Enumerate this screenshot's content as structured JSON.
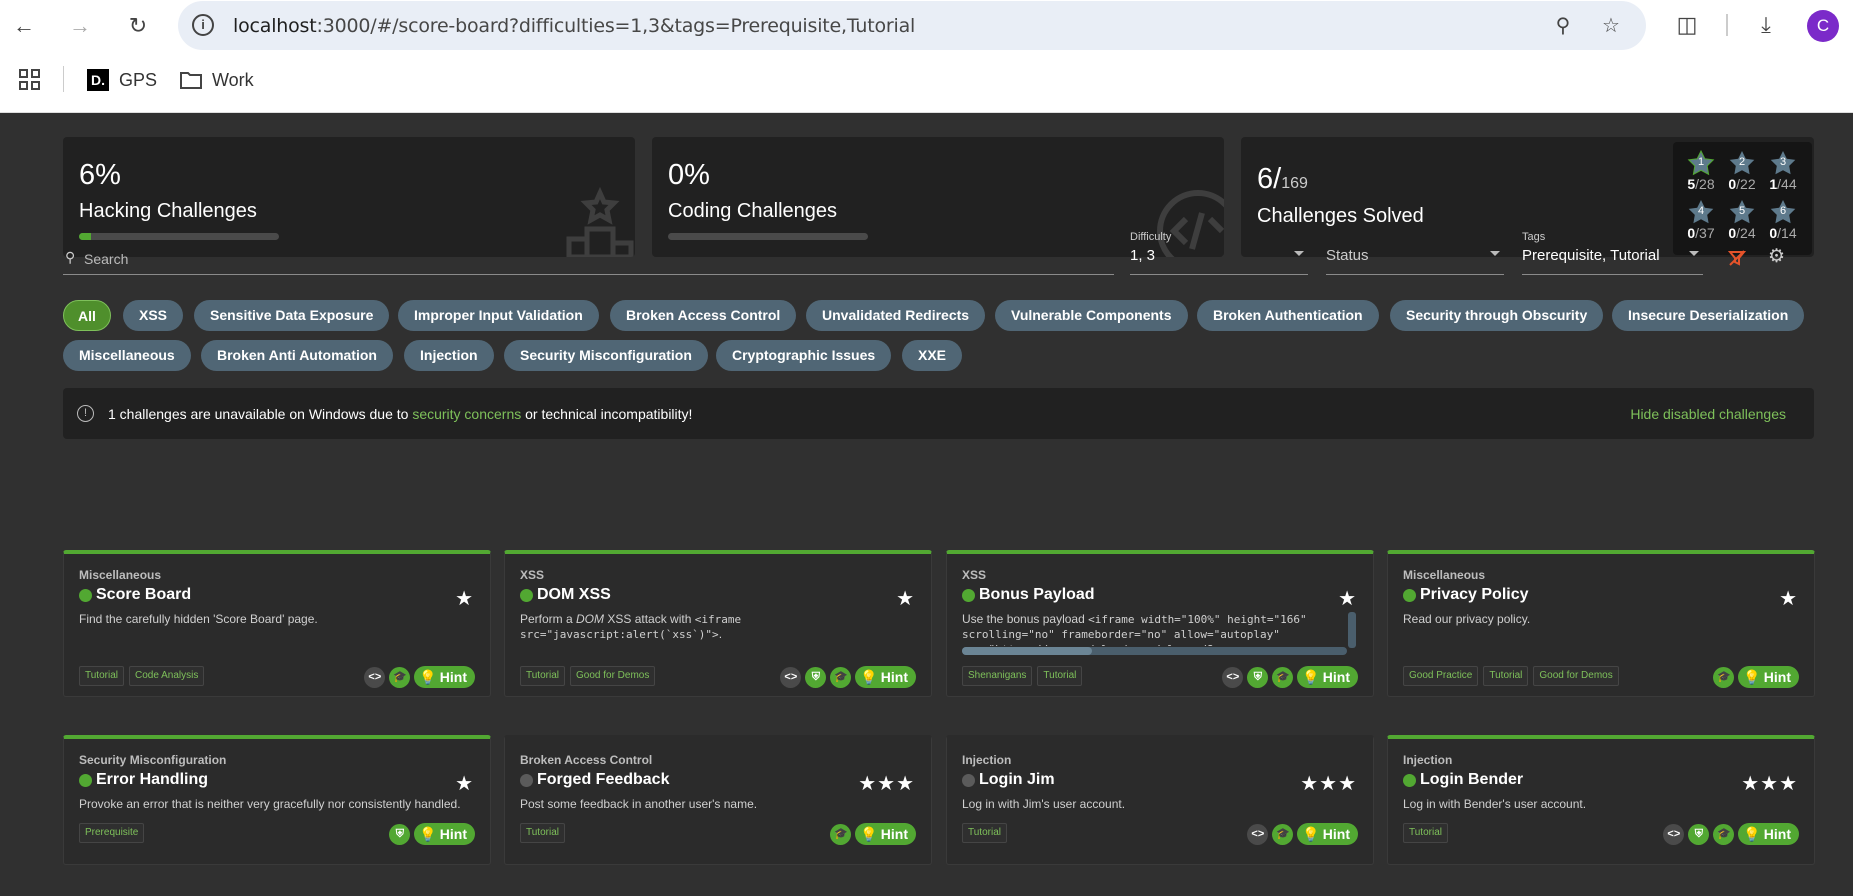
{
  "browser": {
    "url_host": "localhost",
    "url_path": ":3000/#/score-board?difficulties=1,3&tags=Prerequisite,Tutorial",
    "avatar_letter": "C",
    "bookmarks": [
      {
        "label": "GPS",
        "icon": "d-logo"
      },
      {
        "label": "Work",
        "icon": "folder-icon"
      }
    ]
  },
  "stats": {
    "hacking": {
      "percent": "6%",
      "label": "Hacking Challenges",
      "progress": 0.06
    },
    "coding": {
      "percent": "0%",
      "label": "Coding Challenges",
      "progress": 0.0
    },
    "solved": {
      "count": "6/",
      "total": "169",
      "label": "Challenges Solved"
    },
    "difficulty_breakdown": [
      {
        "level": "1",
        "solved": "5",
        "total": "/28"
      },
      {
        "level": "2",
        "solved": "0",
        "total": "/22"
      },
      {
        "level": "3",
        "solved": "1",
        "total": "/44"
      },
      {
        "level": "4",
        "solved": "0",
        "total": "/37"
      },
      {
        "level": "5",
        "solved": "0",
        "total": "/24"
      },
      {
        "level": "6",
        "solved": "0",
        "total": "/14"
      }
    ]
  },
  "filters": {
    "search_placeholder": "Search",
    "difficulty_label": "Difficulty",
    "difficulty_value": "1, 3",
    "status_label": "Status",
    "tags_label": "Tags",
    "tags_value": "Prerequisite, Tutorial"
  },
  "categories": [
    "All",
    "XSS",
    "Sensitive Data Exposure",
    "Improper Input Validation",
    "Broken Access Control",
    "Unvalidated Redirects",
    "Vulnerable Components",
    "Broken Authentication",
    "Security through Obscurity",
    "Insecure Deserialization",
    "Miscellaneous",
    "Broken Anti Automation",
    "Injection",
    "Security Misconfiguration",
    "Cryptographic Issues",
    "XXE"
  ],
  "notice": {
    "text_before": "1 challenges are unavailable on Windows due to ",
    "link": "security concerns",
    "text_after": " or technical incompatibility!",
    "hide": "Hide disabled challenges"
  },
  "challenges": [
    {
      "category": "Miscellaneous",
      "title": "Score Board",
      "stars": "★",
      "solved": true,
      "desc": "Find the carefully hidden 'Score Board' page.",
      "tags": [
        "Tutorial",
        "Code Analysis"
      ],
      "hint": "Hint"
    },
    {
      "category": "XSS",
      "title": "DOM XSS",
      "stars": "★",
      "solved": true,
      "desc_a": "Perform a ",
      "desc_em": "DOM",
      "desc_b": " XSS attack with ",
      "desc_code": "<iframe src=\"javascript:alert(`xss`)\">",
      "desc_c": ".",
      "tags": [
        "Tutorial",
        "Good for Demos"
      ],
      "hint": "Hint"
    },
    {
      "category": "XSS",
      "title": "Bonus Payload",
      "stars": "★",
      "solved": true,
      "desc_a": "Use the bonus payload ",
      "desc_code": "<iframe width=\"100%\" height=\"166\" scrolling=\"no\" frameborder=\"no\" allow=\"autoplay\" src=\"https://w.soundcloud.com/player/?",
      "tags": [
        "Shenanigans",
        "Tutorial"
      ],
      "hint": "Hint"
    },
    {
      "category": "Miscellaneous",
      "title": "Privacy Policy",
      "stars": "★",
      "solved": true,
      "desc": "Read our privacy policy.",
      "tags": [
        "Good Practice",
        "Tutorial",
        "Good for Demos"
      ],
      "hint": "Hint"
    },
    {
      "category": "Security Misconfiguration",
      "title": "Error Handling",
      "stars": "★",
      "solved": true,
      "desc": "Provoke an error that is neither very gracefully nor consistently handled.",
      "tags": [
        "Prerequisite"
      ],
      "hint": "Hint"
    },
    {
      "category": "Broken Access Control",
      "title": "Forged Feedback",
      "stars": "★★★",
      "solved": false,
      "desc": "Post some feedback in another user's name.",
      "tags": [
        "Tutorial"
      ],
      "hint": "Hint"
    },
    {
      "category": "Injection",
      "title": "Login Jim",
      "stars": "★★★",
      "solved": false,
      "desc": "Log in with Jim's user account.",
      "tags": [
        "Tutorial"
      ],
      "hint": "Hint"
    },
    {
      "category": "Injection",
      "title": "Login Bender",
      "stars": "★★★",
      "solved": true,
      "desc": "Log in with Bender's user account.",
      "tags": [
        "Tutorial"
      ],
      "hint": "Hint"
    }
  ],
  "colors": {
    "accent": "#52a832",
    "chip": "#506675",
    "background": "#303030",
    "card": "#2b2b2b"
  }
}
